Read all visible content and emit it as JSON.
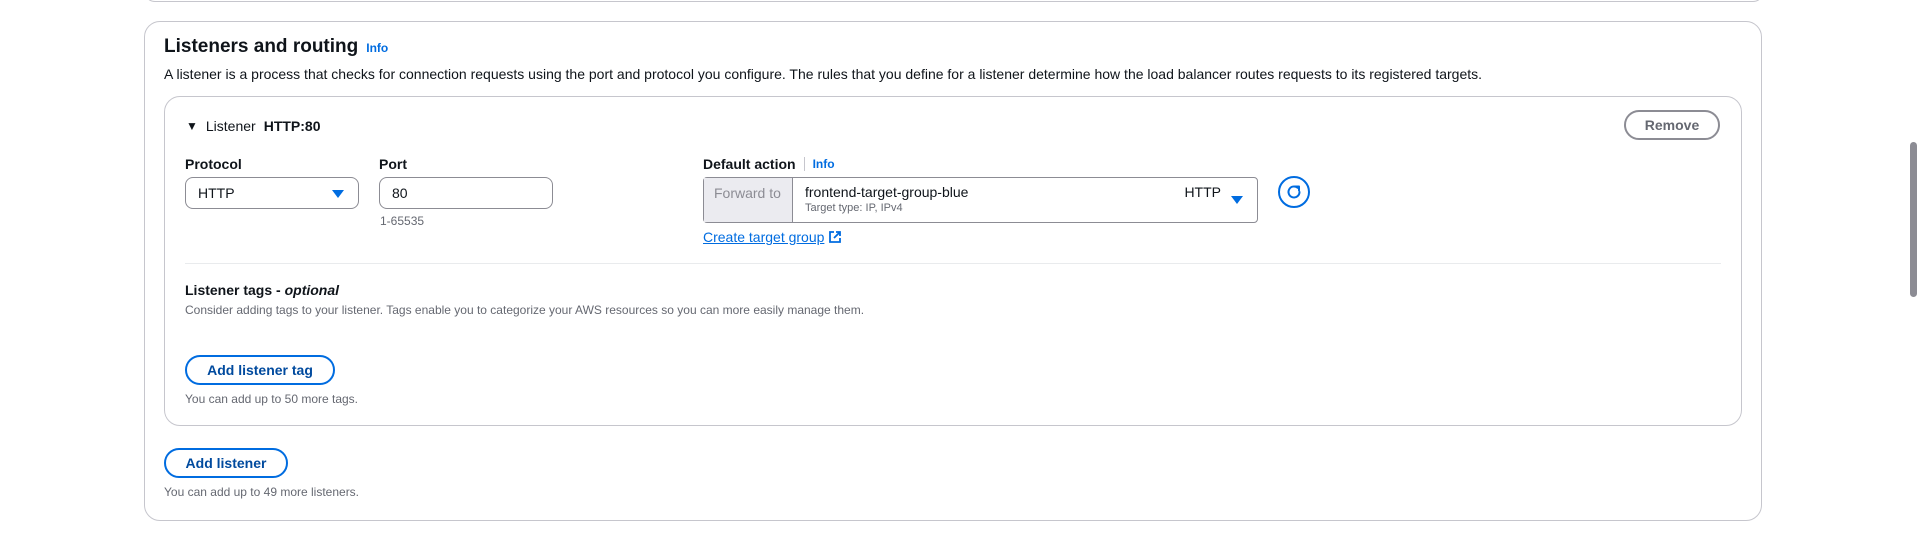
{
  "section": {
    "title": "Listeners and routing",
    "info_label": "Info",
    "description": "A listener is a process that checks for connection requests using the port and protocol you configure. The rules that you define for a listener determine how the load balancer routes requests to its registered targets."
  },
  "listener": {
    "heading_prefix": "Listener",
    "heading_value": "HTTP:80",
    "remove_label": "Remove",
    "protocol": {
      "label": "Protocol",
      "value": "HTTP"
    },
    "port": {
      "label": "Port",
      "value": "80",
      "hint": "1-65535"
    },
    "default_action": {
      "label": "Default action",
      "info_label": "Info",
      "forward_label": "Forward to",
      "target_group_name": "frontend-target-group-blue",
      "target_group_detail": "Target type: IP, IPv4",
      "target_group_protocol": "HTTP",
      "create_link": "Create target group"
    },
    "tags": {
      "title": "Listener tags - ",
      "title_optional": "optional",
      "description": "Consider adding tags to your listener. Tags enable you to categorize your AWS resources so you can more easily manage them.",
      "add_button": "Add listener tag",
      "limit_note": "You can add up to 50 more tags."
    }
  },
  "add_listener": {
    "button": "Add listener",
    "limit_note": "You can add up to 49 more listeners."
  },
  "icons": {
    "caret": "caret-down-icon",
    "dropdown": "dropdown-triangle-icon",
    "refresh": "refresh-icon",
    "external": "external-link-icon"
  },
  "colors": {
    "link": "#006ce0",
    "border": "#c6c6cd",
    "text": "#0f141a",
    "muted": "#656871"
  }
}
